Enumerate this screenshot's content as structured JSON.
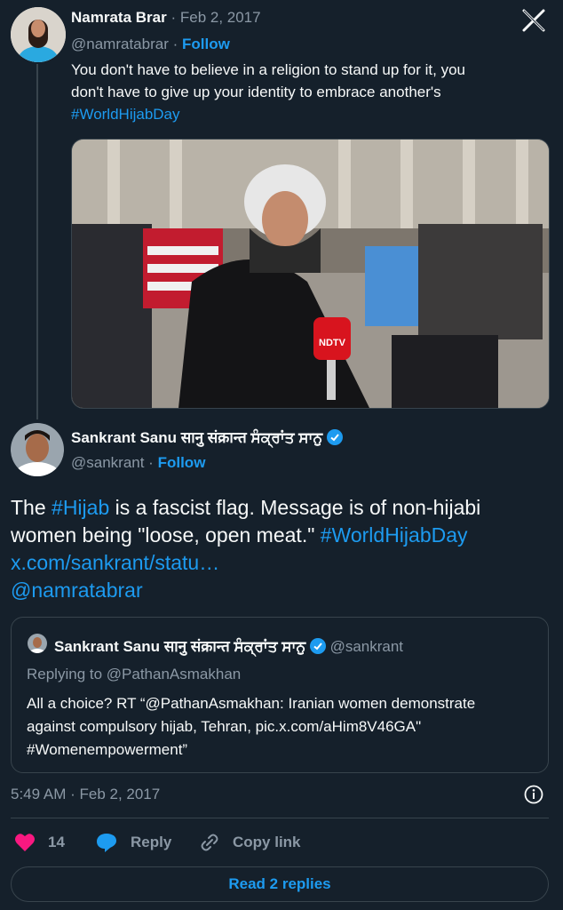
{
  "first_tweet": {
    "author_name": "Namrata Brar",
    "date": "· Feb 2, 2017",
    "handle": "@namratabrar ·",
    "follow_label": "Follow",
    "text_line1": "You don't have to believe in a religion to stand up for it, you",
    "text_line2": "don't have to give up your identity to embrace another's",
    "hashtag": "#WorldHijabDay",
    "photo_mic_label": "NDTV"
  },
  "main_tweet": {
    "author_name": "Sankrant Sanu सानु संक्रान्त ਸੰਕ੍ਰਾਂਤ ਸਾਨੁ",
    "handle": "@sankrant ·",
    "follow_label": "Follow",
    "text_part1": "The ",
    "hashtag_hijab": "#Hijab",
    "text_part2": " is a fascist flag. Message is of non-hijabi",
    "text_line2": "women being \"loose, open meat.\" ",
    "hashtag_worldhijabday": "#WorldHijabDay",
    "link": "x.com/sankrant/statu…",
    "mention": "@namratabrar",
    "timestamp": "5:49 AM · Feb 2, 2017"
  },
  "quoted_tweet": {
    "author_name": "Sankrant Sanu सानु संक्रान्त ਸੰਕ੍ਰਾਂਤ ਸਾਨੁ",
    "handle": "@sankrant",
    "replying_to": "Replying to @PathanAsmakhan",
    "line1": "All a choice? RT “@PathanAsmakhan: Iranian women demonstrate",
    "line2": "against compulsory hijab, Tehran,  pic.x.com/aHim8V46GA\"",
    "line3": "#Womenempowerment”"
  },
  "actions": {
    "like_count": "14",
    "reply_label": "Reply",
    "copy_link_label": "Copy link",
    "read_replies_label": "Read 2 replies"
  },
  "icons": {
    "x_logo": "x-logo-icon",
    "verified": "verified-badge-icon",
    "heart": "heart-icon",
    "reply": "reply-bubble-icon",
    "link": "link-icon",
    "info": "info-icon"
  },
  "colors": {
    "background": "#15202b",
    "accent": "#1d9bf0",
    "like": "#f91880",
    "muted": "#8b98a5",
    "border": "#38444d"
  }
}
